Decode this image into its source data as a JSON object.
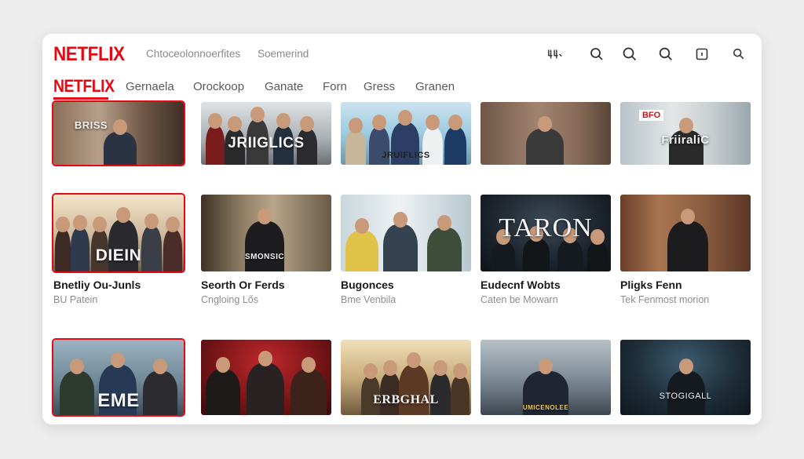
{
  "header": {
    "logo": "NETFLIX",
    "links": [
      "Chtoceolonnoerfites",
      "Soemerind"
    ],
    "icons": [
      "account-icon",
      "search-icon",
      "search-icon",
      "search-icon",
      "square-icon",
      "search-icon"
    ]
  },
  "nav": {
    "logo": "NETFLIX",
    "items": [
      "Gernaela",
      "Orockoop",
      "Ganate",
      "Forn",
      "Gress",
      "Granen"
    ]
  },
  "rows": [
    {
      "tiles": [
        {
          "title": "BRISS"
        },
        {
          "title": "JRIIGLICS"
        },
        {
          "title": "JRUIFLICS"
        },
        {
          "title": ""
        },
        {
          "title": "FriiraliC",
          "badge": "BFO"
        }
      ]
    },
    {
      "tiles": [
        {
          "title": "DIEIN",
          "name": "Bnetliy Ou-Junls",
          "sub": "BU Patein"
        },
        {
          "title": "SMONSIC",
          "name": "Seorth Or Ferds",
          "sub": "Cngloing Lős"
        },
        {
          "title": "",
          "name": "Bugonces",
          "sub": "Bme Venbila"
        },
        {
          "title": "TARON",
          "name": "Eudecnf Wobts",
          "sub": "Caten be Mowarn"
        },
        {
          "title": "",
          "name": "Pligks Fenn",
          "sub": "Tek Fenmost morion"
        }
      ]
    },
    {
      "tiles": [
        {
          "title": "EME"
        },
        {
          "title": ""
        },
        {
          "title": "ERBGHAL"
        },
        {
          "title": "UMICENOLEE"
        },
        {
          "title": "STOGIGALL"
        }
      ]
    }
  ],
  "colors": {
    "brand": "#e50914",
    "background": "#ededed",
    "panel": "#ffffff"
  }
}
